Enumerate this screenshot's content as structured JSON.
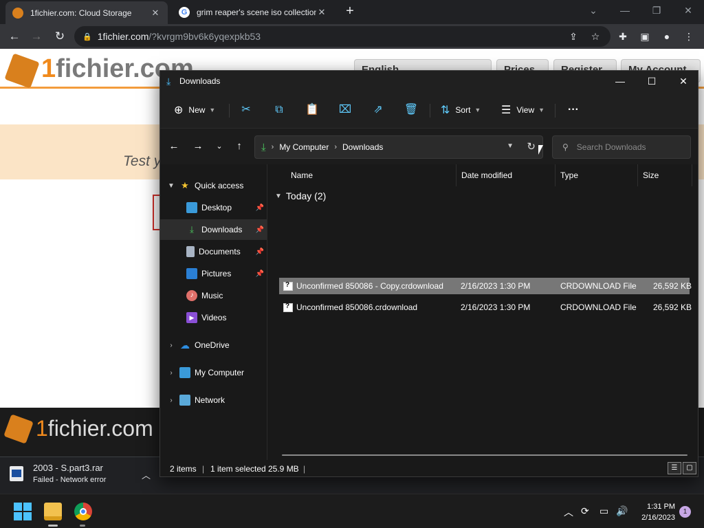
{
  "browser": {
    "tabs": [
      {
        "title": "1fichier.com: Cloud Storage",
        "active": true
      },
      {
        "title": "grim reaper's scene iso collection",
        "active": false
      }
    ],
    "url_host": "1fichier.com",
    "url_path": "/?kvrgm9bv6k6yqexpkb53"
  },
  "site": {
    "logo_one": "1",
    "logo_rest": "fichier.com",
    "buttons": [
      "English",
      "Prices",
      "Register",
      "My Account"
    ],
    "banner_text": "Test y",
    "footer_logo_one": "1",
    "footer_logo_rest": "fichier.com"
  },
  "download": {
    "filename": "2003 - S.part3.rar",
    "status": "Failed - Network error"
  },
  "explorer": {
    "title": "Downloads",
    "commands": {
      "new": "New",
      "sort": "Sort",
      "view": "View"
    },
    "breadcrumb": [
      "My Computer",
      "Downloads"
    ],
    "search_placeholder": "Search Downloads",
    "sidebar": {
      "quick_access": "Quick access",
      "items": [
        "Desktop",
        "Downloads",
        "Documents",
        "Pictures",
        "Music",
        "Videos"
      ],
      "onedrive": "OneDrive",
      "my_computer": "My Computer",
      "network": "Network"
    },
    "columns": {
      "name": "Name",
      "date": "Date modified",
      "type": "Type",
      "size": "Size"
    },
    "group_label": "Today (2)",
    "files": [
      {
        "name": "Unconfirmed 850086 - Copy.crdownload",
        "date": "2/16/2023 1:30 PM",
        "type": "CRDOWNLOAD File",
        "size": "26,592 KB",
        "selected": true
      },
      {
        "name": "Unconfirmed 850086.crdownload",
        "date": "2/16/2023 1:30 PM",
        "type": "CRDOWNLOAD File",
        "size": "26,592 KB",
        "selected": false
      }
    ],
    "status": {
      "items": "2 items",
      "selected": "1 item selected",
      "size": "25.9 MB"
    }
  },
  "taskbar": {
    "time": "1:31 PM",
    "date": "2/16/2023",
    "notifications": "1"
  },
  "colors": {
    "accent": "#60cdff",
    "brand_orange": "#f08a1d",
    "explorer_bg": "#191919"
  }
}
